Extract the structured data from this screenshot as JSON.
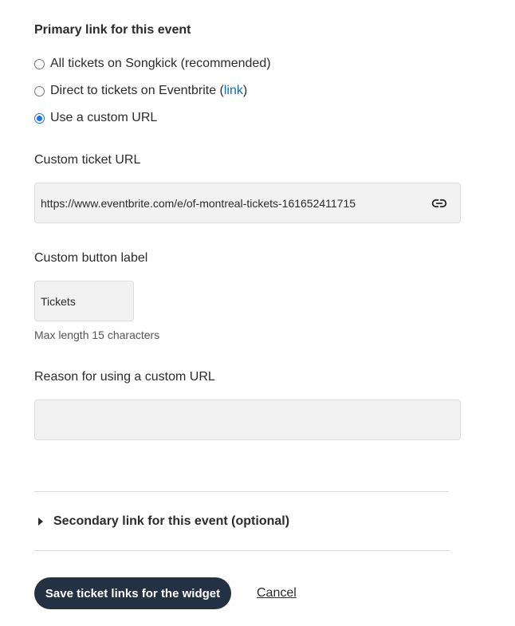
{
  "primary": {
    "title": "Primary link for this event",
    "options": [
      {
        "label": "All tickets on Songkick (recommended)",
        "checked": false
      },
      {
        "label_prefix": "Direct to tickets on Eventbrite (",
        "link_text": "link",
        "label_suffix": ")",
        "checked": false
      },
      {
        "label": "Use a custom URL",
        "checked": true
      }
    ]
  },
  "custom_url": {
    "label": "Custom ticket URL",
    "value": "https://www.eventbrite.com/e/of-montreal-tickets-161652411715",
    "icon": "link-icon"
  },
  "button_label": {
    "label": "Custom button label",
    "value": "Tickets",
    "hint": "Max length 15 characters"
  },
  "reason": {
    "label": "Reason for using a custom URL",
    "value": ""
  },
  "secondary": {
    "label": "Secondary link for this event (optional)",
    "expanded": false
  },
  "actions": {
    "save_label": "Save ticket links for the widget",
    "cancel_label": "Cancel"
  },
  "colors": {
    "accent": "#1a73e8",
    "link": "#0b6fb5",
    "button": "#243142",
    "input_bg": "#f2f2f2"
  }
}
